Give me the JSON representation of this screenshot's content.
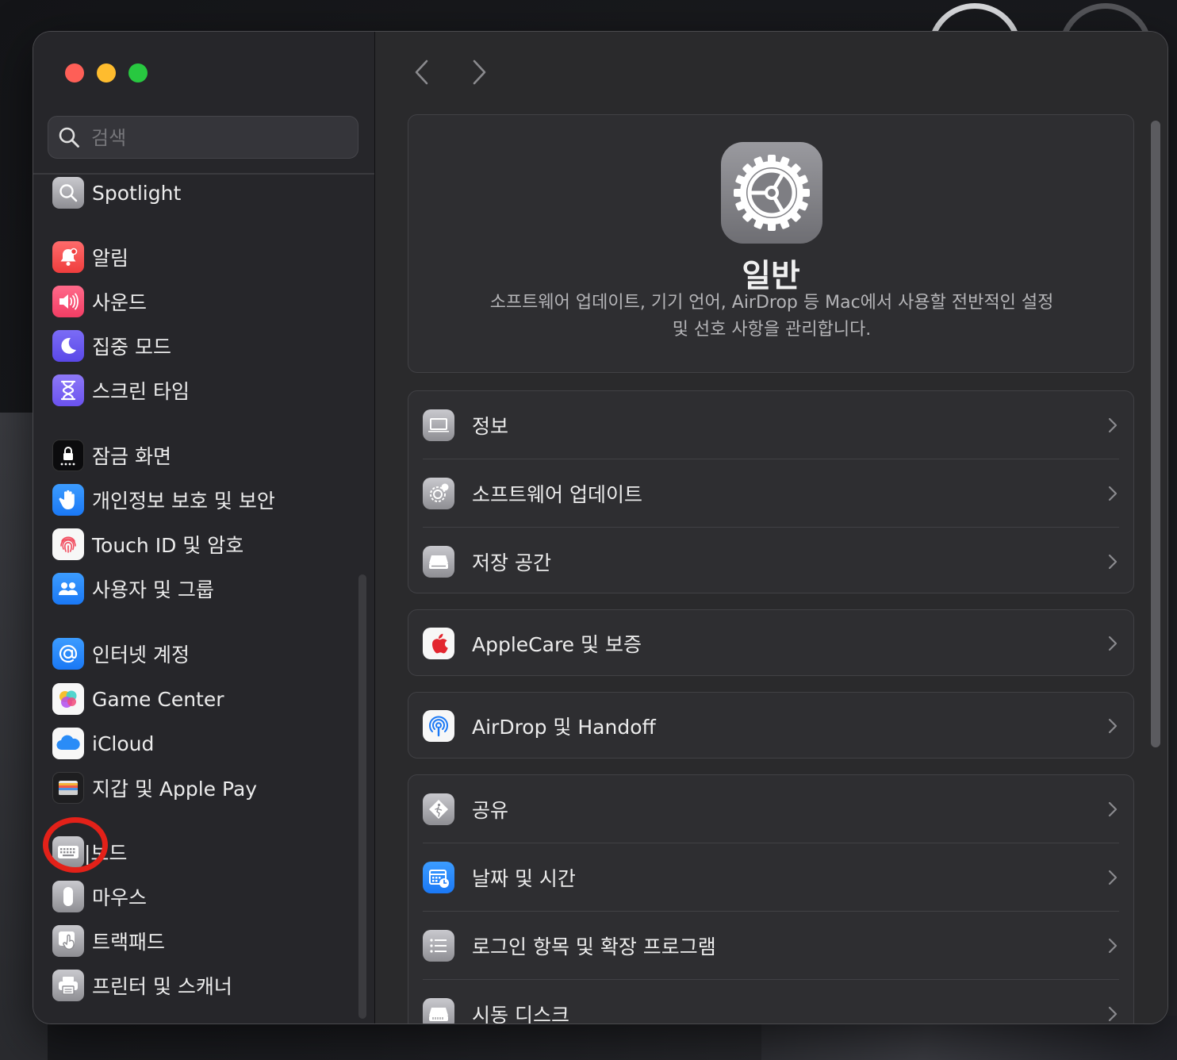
{
  "search": {
    "placeholder": "검색"
  },
  "sidebar": {
    "items": [
      {
        "label": "Spotlight",
        "icon": "spotlight-icon"
      },
      {
        "label": "알림",
        "icon": "bell-icon"
      },
      {
        "label": "사운드",
        "icon": "speaker-icon"
      },
      {
        "label": "집중 모드",
        "icon": "moon-icon"
      },
      {
        "label": "스크린 타임",
        "icon": "hourglass-icon"
      },
      {
        "label": "잠금 화면",
        "icon": "lock-icon"
      },
      {
        "label": "개인정보 보호 및 보안",
        "icon": "hand-icon"
      },
      {
        "label": "Touch ID 및 암호",
        "icon": "fingerprint-icon"
      },
      {
        "label": "사용자 및 그룹",
        "icon": "users-icon"
      },
      {
        "label": "인터넷 계정",
        "icon": "at-icon"
      },
      {
        "label": "Game Center",
        "icon": "game-center-icon"
      },
      {
        "label": "iCloud",
        "icon": "cloud-icon"
      },
      {
        "label": "지갑 및 Apple Pay",
        "icon": "wallet-icon"
      },
      {
        "label": "키보드",
        "visible_label": "|보드",
        "icon": "keyboard-icon"
      },
      {
        "label": "마우스",
        "icon": "mouse-icon"
      },
      {
        "label": "트랙패드",
        "icon": "trackpad-icon"
      },
      {
        "label": "프린터 및 스캐너",
        "icon": "printer-icon"
      }
    ]
  },
  "hero": {
    "title": "일반",
    "description": "소프트웨어 업데이트, 기기 언어, AirDrop 등 Mac에서 사용할 전반적인 설정 및 선호 사항을 관리합니다.",
    "icon": "gear-icon"
  },
  "main": {
    "groups": [
      {
        "rows": [
          {
            "label": "정보",
            "icon": "laptop-icon"
          },
          {
            "label": "소프트웨어 업데이트",
            "icon": "gear-badge-icon"
          },
          {
            "label": "저장 공간",
            "icon": "drive-icon"
          }
        ]
      },
      {
        "rows": [
          {
            "label": "AppleCare 및 보증",
            "icon": "apple-icon"
          }
        ]
      },
      {
        "rows": [
          {
            "label": "AirDrop 및 Handoff",
            "icon": "airdrop-icon"
          }
        ]
      },
      {
        "rows": [
          {
            "label": "공유",
            "icon": "sharing-icon"
          },
          {
            "label": "날짜 및 시간",
            "icon": "calendar-clock-icon"
          },
          {
            "label": "로그인 항목 및 확장 프로그램",
            "icon": "list-icon"
          },
          {
            "label": "시동 디스크",
            "icon": "startup-disk-icon"
          }
        ]
      }
    ]
  },
  "colors": {
    "window_bg": "#2a2a2c",
    "sidebar_bg": "#26262a",
    "annotation": "#e32119",
    "accent_blue": "#1a78f5"
  }
}
